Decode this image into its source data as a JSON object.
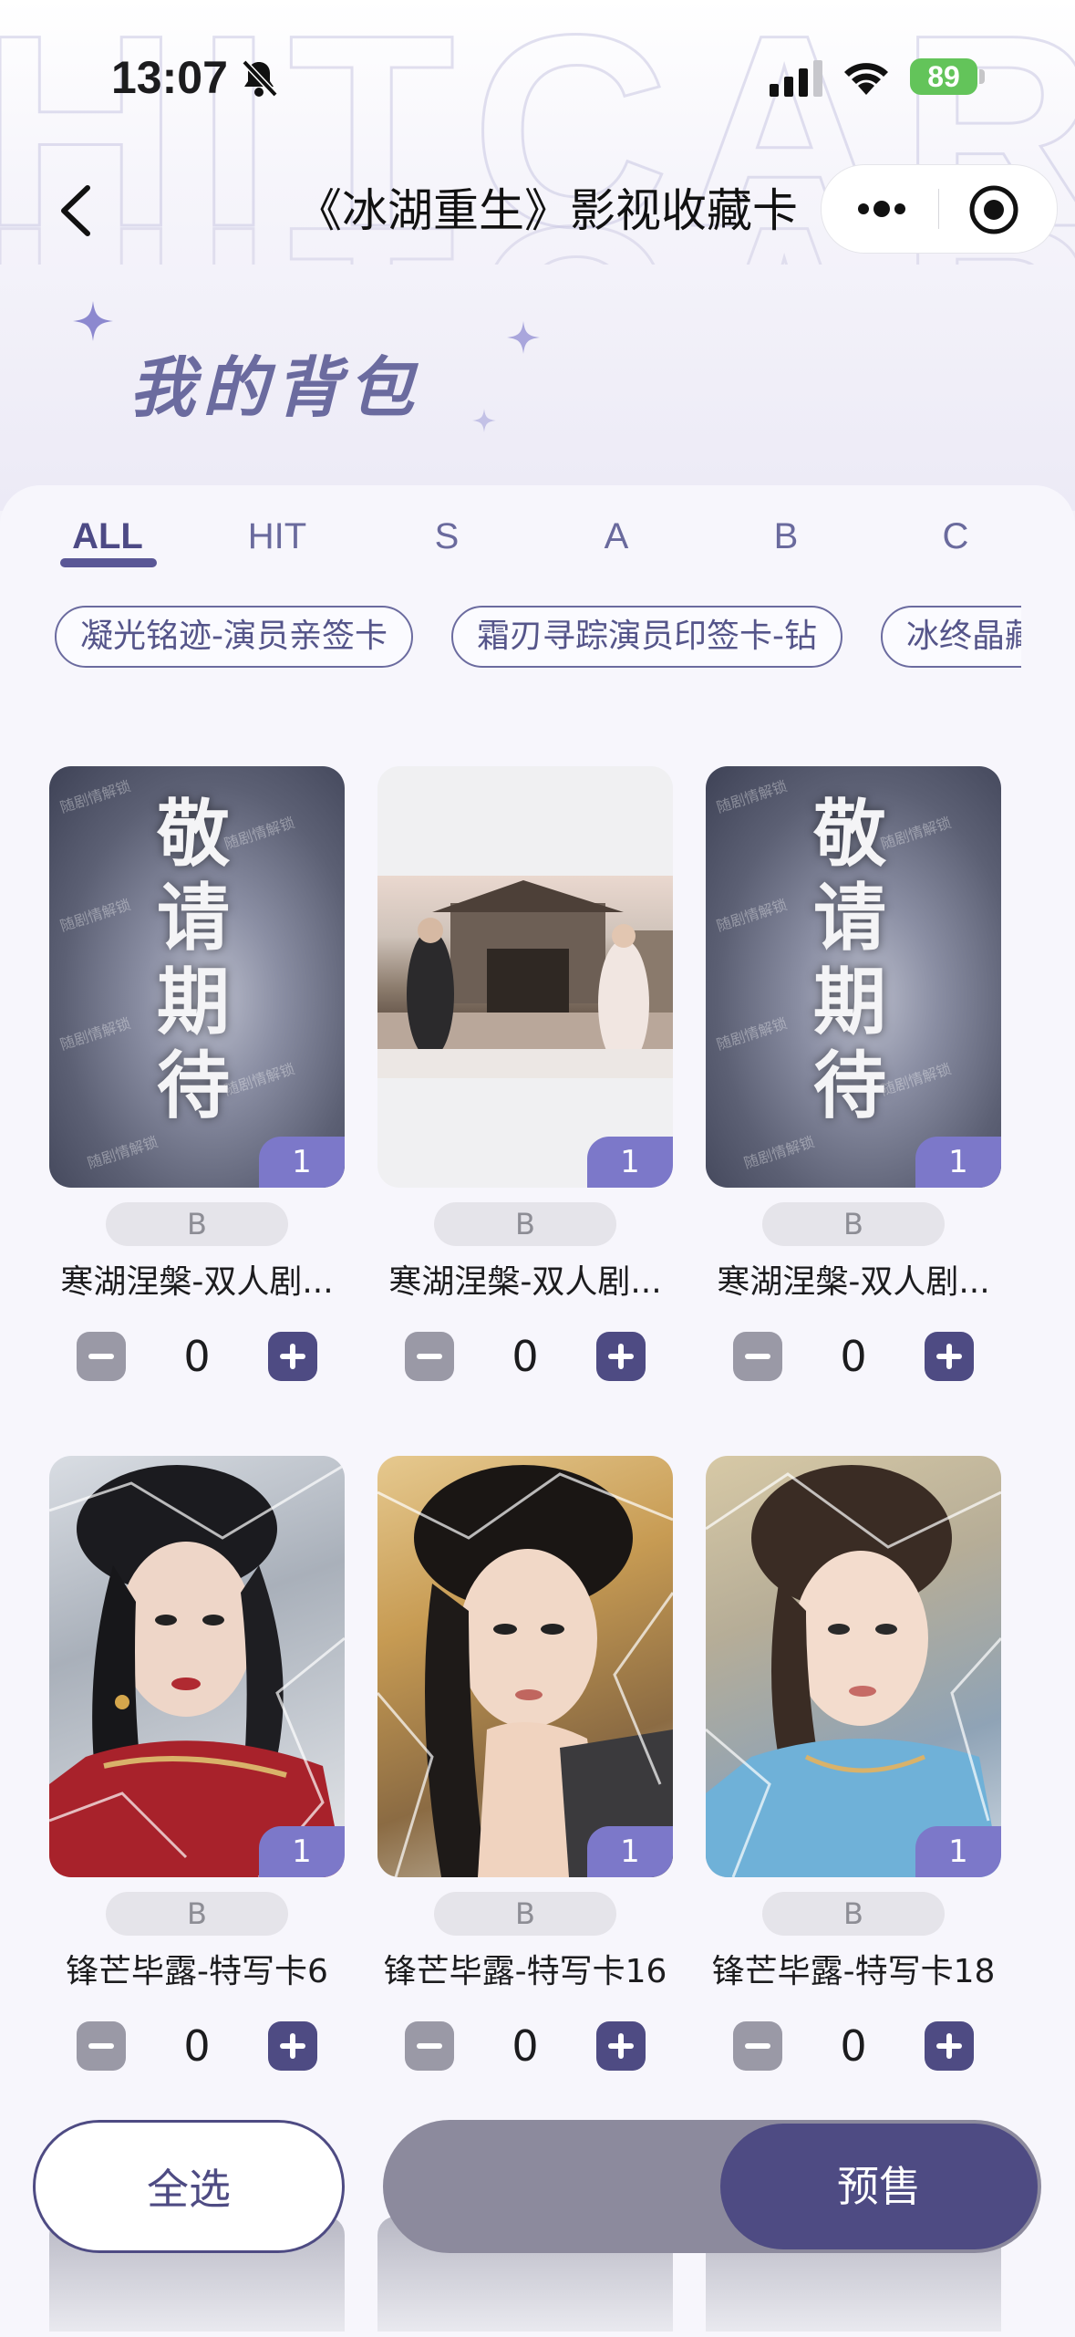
{
  "status_bar": {
    "time": "13:07",
    "battery": "89"
  },
  "nav": {
    "title": "《冰湖重生》影视收藏卡"
  },
  "header": {
    "title": "我的背包"
  },
  "tabs": [
    {
      "label": "ALL",
      "active": true
    },
    {
      "label": "HIT"
    },
    {
      "label": "S"
    },
    {
      "label": "A"
    },
    {
      "label": "B"
    },
    {
      "label": "C"
    }
  ],
  "chips": [
    "凝光铭迹-演员亲签卡",
    "霜刃寻踪演员印签卡-钻",
    "冰终晶藏"
  ],
  "poster_text": [
    "敬",
    "请",
    "期",
    "待"
  ],
  "cards": [
    {
      "name": "寒湖涅槃-双人剧...",
      "grade": "B",
      "badge": "1",
      "count": "0"
    },
    {
      "name": "寒湖涅槃-双人剧...",
      "grade": "B",
      "badge": "1",
      "count": "0"
    },
    {
      "name": "寒湖涅槃-双人剧...",
      "grade": "B",
      "badge": "1",
      "count": "0"
    },
    {
      "name": "锋芒毕露-特写卡6",
      "grade": "B",
      "badge": "1",
      "count": "0"
    },
    {
      "name": "锋芒毕露-特写卡16",
      "grade": "B",
      "badge": "1",
      "count": "0"
    },
    {
      "name": "锋芒毕露-特写卡18",
      "grade": "B",
      "badge": "1",
      "count": "0"
    }
  ],
  "footer": {
    "select_all": "全选",
    "presale": "预售"
  }
}
